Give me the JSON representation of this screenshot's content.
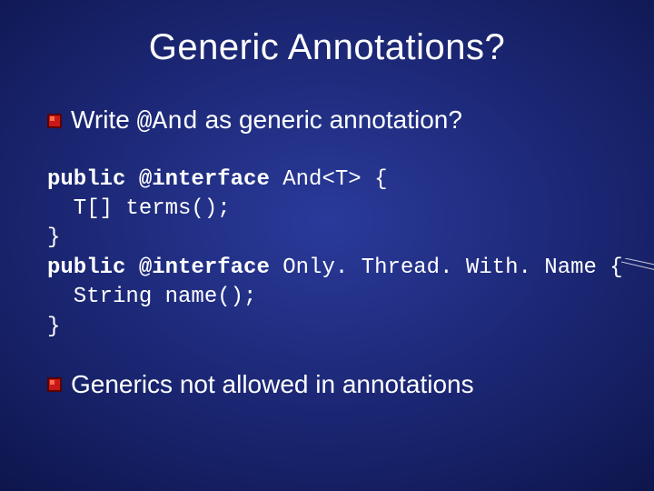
{
  "slide": {
    "title": "Generic Annotations?",
    "bullet1_pre": "Write ",
    "bullet1_code": "@And",
    "bullet1_post": " as generic annotation?",
    "code": {
      "l1a": "public @interface",
      "l1b": " And<T> {",
      "l2": "  T[] terms();",
      "l3": "}",
      "l4a": "public @interface",
      "l4b": " Only. Thread. With. Name {",
      "l5": "  String name();",
      "l6": "}"
    },
    "bullet2": "Generics not allowed in annotations"
  },
  "icons": {
    "bullet": "square-bullet-icon"
  },
  "colors": {
    "bullet_outer": "#7a0000",
    "bullet_inner": "#e02020",
    "text": "#ffffff"
  }
}
